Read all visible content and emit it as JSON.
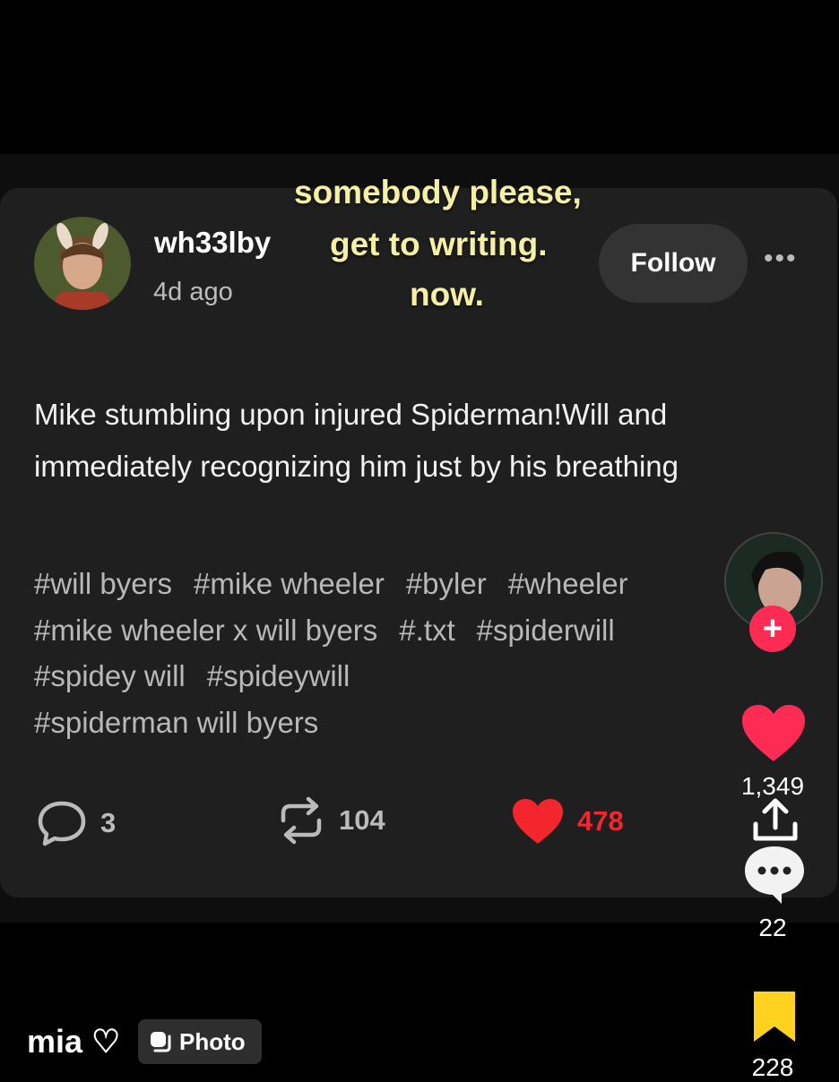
{
  "overlay_text": [
    "somebody please,",
    "get to writing.",
    "now."
  ],
  "post": {
    "username": "wh33lby",
    "time": "4d ago",
    "follow_label": "Follow",
    "more_label": "•••",
    "body": "Mike stumbling upon injured Spiderman!Will and immediately recognizing him just by his breathing",
    "tags": [
      "#will byers",
      "#mike wheeler",
      "#byler",
      "#wheeler",
      "#mike wheeler x will byers",
      "#.txt",
      "#spiderwill",
      "#spidey will",
      "#spideywill",
      "#spiderman will byers"
    ],
    "comments_count": "3",
    "reblogs_count": "104",
    "likes_count": "478"
  },
  "sidebar": {
    "likes": "1,349",
    "comments": "22",
    "saves": "228"
  },
  "footer": {
    "handle": "mia ♡",
    "badge_label": "Photo"
  },
  "colors": {
    "overlay": "#f6efa6",
    "like_red": "#f2262c",
    "tiktok_red": "#fe2c55",
    "save_yellow": "#ffd21f"
  }
}
